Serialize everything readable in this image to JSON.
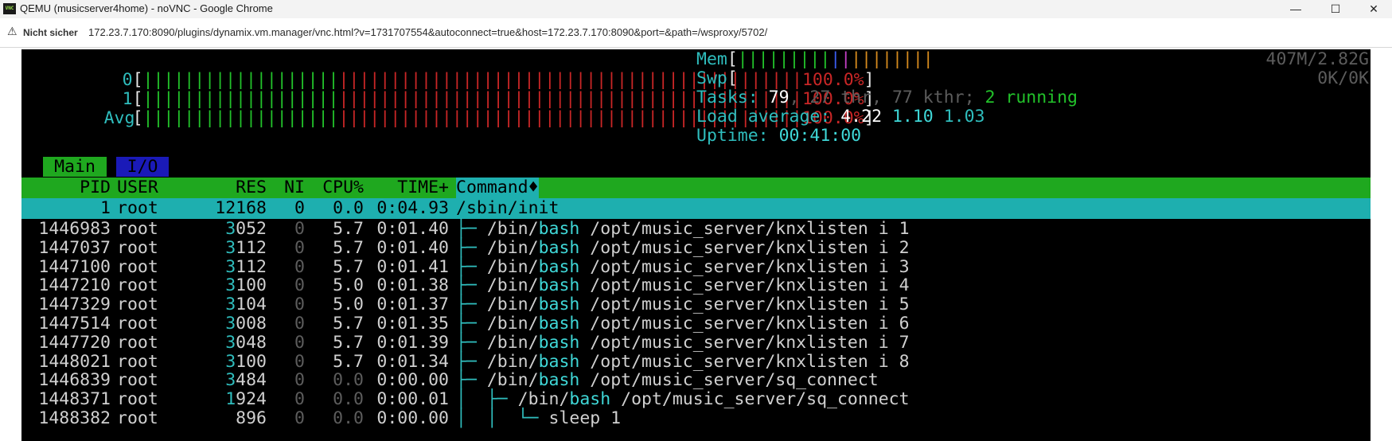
{
  "window": {
    "title": "QEMU (musicserver4home) - noVNC - Google Chrome",
    "app_icon_text": "VNC",
    "controls": {
      "minimize": "—",
      "maximize": "☐",
      "close": "✕"
    }
  },
  "address_bar": {
    "security_label": "Nicht sicher",
    "url": "172.23.7.170:8090/plugins/dynamix.vm.manager/vnc.html?v=1731707554&autoconnect=true&host=172.23.7.170:8090&port=&path=/wsproxy/5702/"
  },
  "htop": {
    "cpus": [
      {
        "label": "0",
        "percent_text": "100.0%",
        "usage": 1.0
      },
      {
        "label": "1",
        "percent_text": "100.0%",
        "usage": 1.0
      },
      {
        "label": "Avg",
        "percent_text": "100.0%",
        "usage": 1.0
      }
    ],
    "mem": {
      "label": "Mem",
      "value": "407M/2.82G"
    },
    "swap": {
      "label": "Swp",
      "value": "0K/0K"
    },
    "tasks": {
      "label": "Tasks:",
      "count": "79",
      "thr": "27 thr,",
      "kthr": "77 kthr;",
      "running_count": "2",
      "running_label": "running"
    },
    "load": {
      "label": "Load average:",
      "one": "4.22",
      "five": "1.10",
      "fifteen": "1.03"
    },
    "uptime": {
      "label": "Uptime:",
      "value": "00:41:00"
    },
    "tabs": {
      "main": "Main",
      "io": "I/O"
    },
    "columns": {
      "pid": "PID",
      "user": "USER",
      "res": "RES",
      "ni": "NI",
      "cpu": "CPU%",
      "time": "TIME+",
      "command": "Command"
    },
    "sort_indicator": "♦",
    "selected": {
      "pid": "1",
      "user": "root",
      "res": "12168",
      "ni": "0",
      "cpu": "0.0",
      "time": "0:04.93",
      "command": "/sbin/init"
    },
    "processes": [
      {
        "pid": "1446983",
        "user": "root",
        "res_head": "3",
        "res_tail": "052",
        "ni": "0",
        "cpu": "5.7",
        "time": "0:01.40",
        "tree": "├─ ",
        "path": "/bin/",
        "bin": "bash",
        "args": " /opt/music_server/knxlisten i 1"
      },
      {
        "pid": "1447037",
        "user": "root",
        "res_head": "3",
        "res_tail": "112",
        "ni": "0",
        "cpu": "5.7",
        "time": "0:01.40",
        "tree": "├─ ",
        "path": "/bin/",
        "bin": "bash",
        "args": " /opt/music_server/knxlisten i 2"
      },
      {
        "pid": "1447100",
        "user": "root",
        "res_head": "3",
        "res_tail": "112",
        "ni": "0",
        "cpu": "5.7",
        "time": "0:01.41",
        "tree": "├─ ",
        "path": "/bin/",
        "bin": "bash",
        "args": " /opt/music_server/knxlisten i 3"
      },
      {
        "pid": "1447210",
        "user": "root",
        "res_head": "3",
        "res_tail": "100",
        "ni": "0",
        "cpu": "5.0",
        "time": "0:01.38",
        "tree": "├─ ",
        "path": "/bin/",
        "bin": "bash",
        "args": " /opt/music_server/knxlisten i 4"
      },
      {
        "pid": "1447329",
        "user": "root",
        "res_head": "3",
        "res_tail": "104",
        "ni": "0",
        "cpu": "5.0",
        "time": "0:01.37",
        "tree": "├─ ",
        "path": "/bin/",
        "bin": "bash",
        "args": " /opt/music_server/knxlisten i 5"
      },
      {
        "pid": "1447514",
        "user": "root",
        "res_head": "3",
        "res_tail": "008",
        "ni": "0",
        "cpu": "5.7",
        "time": "0:01.35",
        "tree": "├─ ",
        "path": "/bin/",
        "bin": "bash",
        "args": " /opt/music_server/knxlisten i 6"
      },
      {
        "pid": "1447720",
        "user": "root",
        "res_head": "3",
        "res_tail": "048",
        "ni": "0",
        "cpu": "5.7",
        "time": "0:01.39",
        "tree": "├─ ",
        "path": "/bin/",
        "bin": "bash",
        "args": " /opt/music_server/knxlisten i 7"
      },
      {
        "pid": "1448021",
        "user": "root",
        "res_head": "3",
        "res_tail": "100",
        "ni": "0",
        "cpu": "5.7",
        "time": "0:01.34",
        "tree": "├─ ",
        "path": "/bin/",
        "bin": "bash",
        "args": " /opt/music_server/knxlisten i 8"
      },
      {
        "pid": "1446839",
        "user": "root",
        "res_head": "3",
        "res_tail": "484",
        "ni": "0",
        "cpu": "0.0",
        "time": "0:00.00",
        "tree": "├─ ",
        "path": "/bin/",
        "bin": "bash",
        "args": " /opt/music_server/sq_connect"
      },
      {
        "pid": "1448371",
        "user": "root",
        "res_head": "1",
        "res_tail": "924",
        "ni": "0",
        "cpu": "0.0",
        "time": "0:00.01",
        "tree": "│  ├─ ",
        "path": "/bin/",
        "bin": "bash",
        "args": " /opt/music_server/sq_connect"
      },
      {
        "pid": "1488382",
        "user": "root",
        "res_head": "",
        "res_tail": "896",
        "ni": "0",
        "cpu": "0.0",
        "time": "0:00.00",
        "tree": "│  │  └─ ",
        "path": "",
        "bin": "",
        "args": "sleep 1"
      }
    ],
    "colors": {
      "header": "#1fa81f",
      "selection": "#1eafaf",
      "io_tab": "#1a1ab8"
    }
  }
}
